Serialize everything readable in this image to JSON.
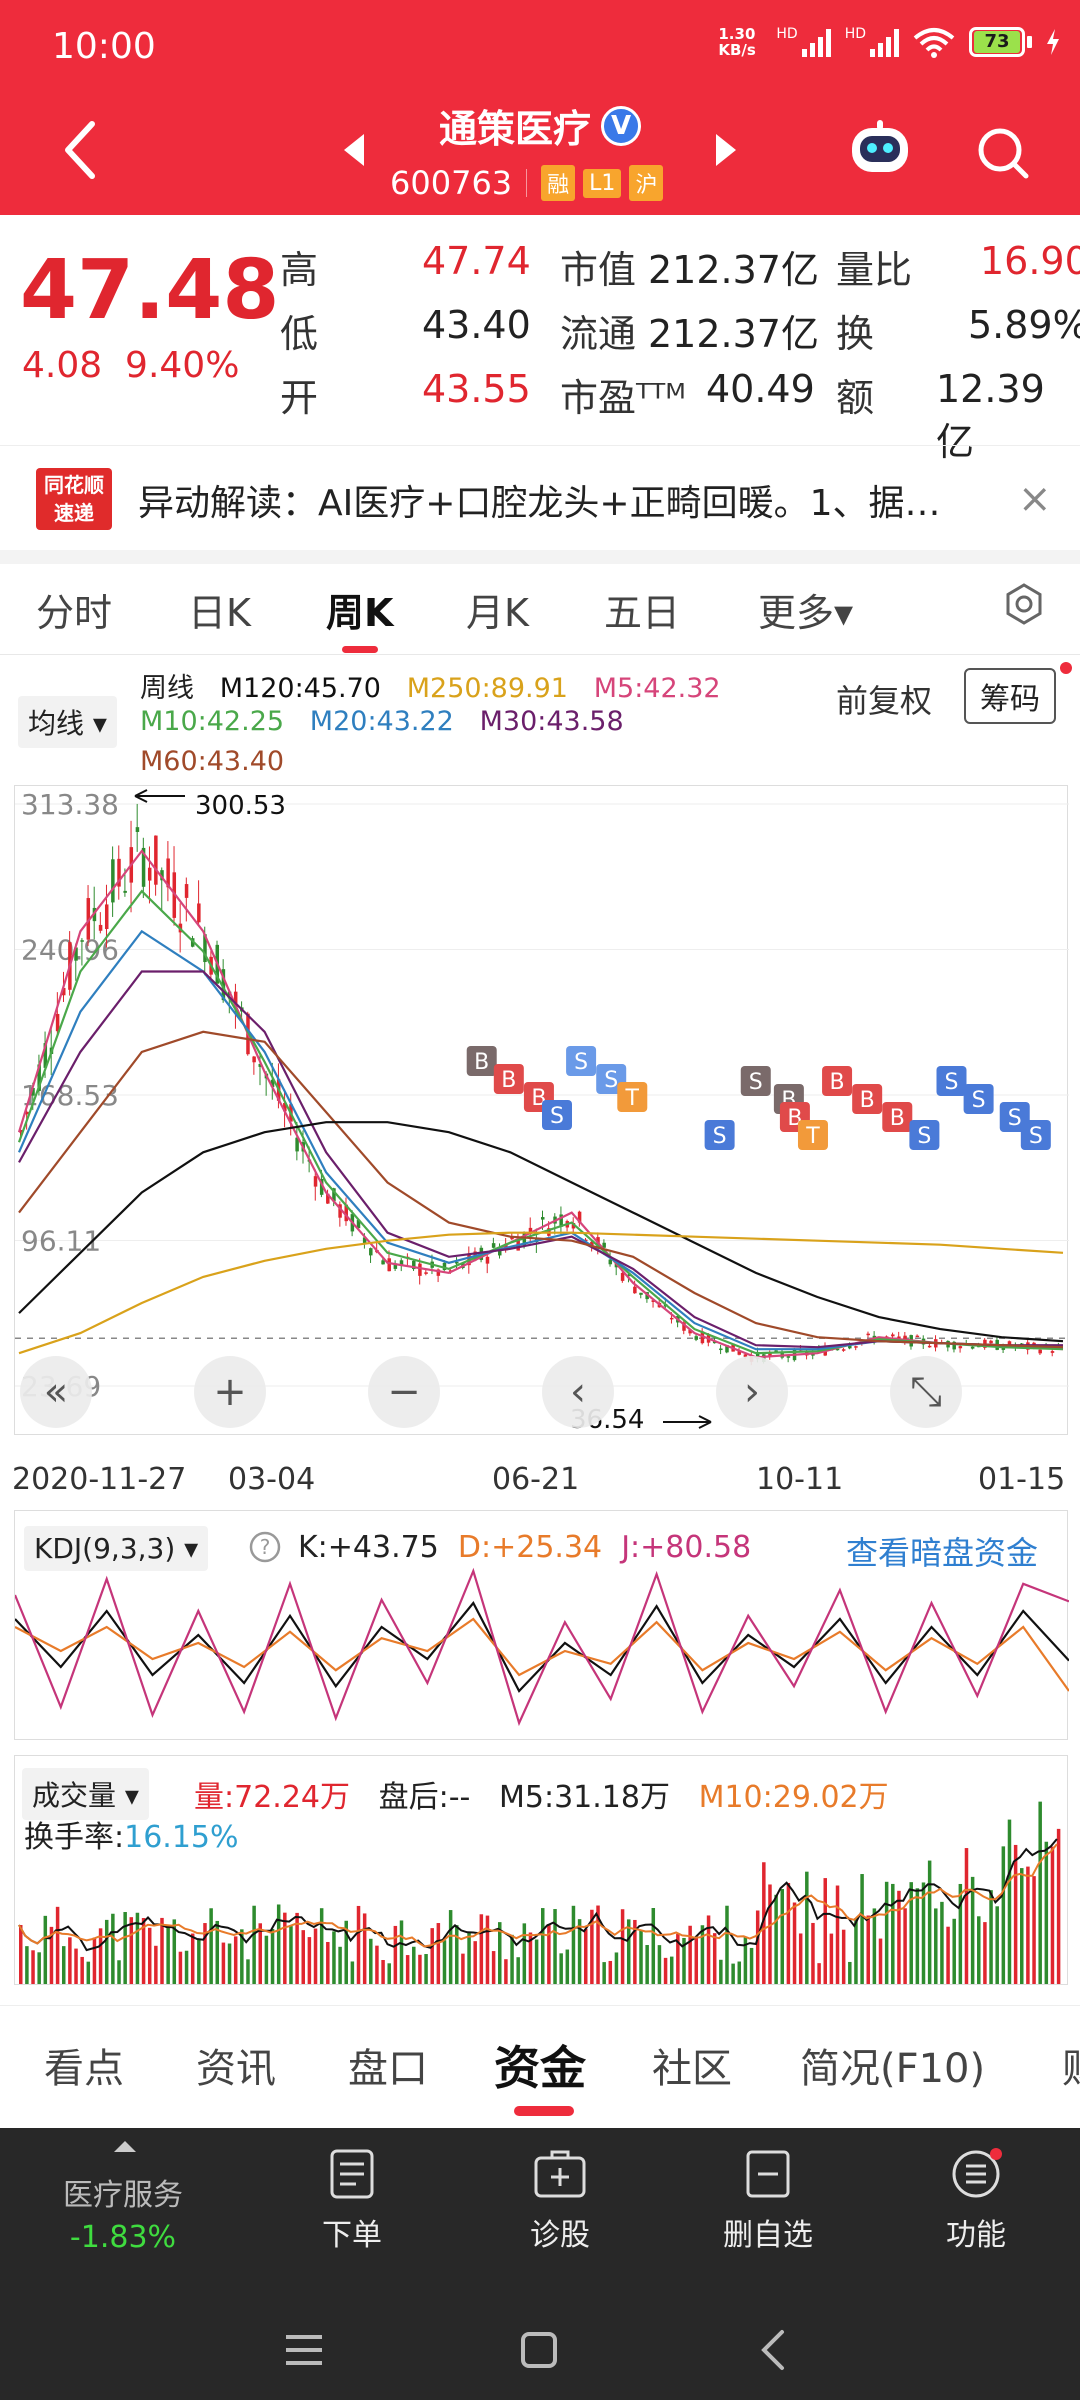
{
  "status": {
    "time": "10:00",
    "net_speed": "1.30 KB/s",
    "battery": "73",
    "hd1": "HD",
    "hd2": "HD"
  },
  "header": {
    "stock_name": "通策医疗",
    "verified": "V",
    "code": "600763",
    "tags": [
      "融",
      "L1",
      "沪"
    ]
  },
  "quote": {
    "price": "47.48",
    "change": "4.08",
    "change_pct": "9.40%",
    "high_label": "高",
    "high": "47.74",
    "low_label": "低",
    "low": "43.40",
    "open_label": "开",
    "open": "43.55",
    "mktcap_label": "市值",
    "mktcap": "212.37亿",
    "float_label": "流通",
    "float": "212.37亿",
    "pe_label": "市盈ᵀᵀᴹ",
    "pe": "40.49",
    "vr_label": "量比",
    "vr": "16.90",
    "turn_label": "换",
    "turn": "5.89%",
    "amt_label": "额",
    "amt": "12.39亿"
  },
  "news": {
    "logo_line1": "同花顺",
    "logo_line2": "速递",
    "text": "异动解读：AI医疗+口腔龙头+正畸回暖。1、据…",
    "close": "×"
  },
  "period_tabs": [
    "分时",
    "日K",
    "周K",
    "月K",
    "五日",
    "更多▾"
  ],
  "ma": {
    "selector": "均线 ▾",
    "prefix": "周线",
    "m120": "M120:45.70",
    "m250": "M250:89.91",
    "m5": "M5:42.32",
    "m10": "M10:42.25",
    "m20": "M20:43.22",
    "m30": "M30:43.58",
    "m60": "M60:43.40",
    "adjust": "前复权",
    "chips": "筹码"
  },
  "colors": {
    "accent": "#ee2c3c",
    "up": "#e0262f",
    "down": "#2e8b2e",
    "m5": "#d6457a",
    "m10": "#4aa84a",
    "m20": "#2f7fbf",
    "m30": "#6b1f6b",
    "m60": "#a04a2a",
    "m120": "#111111",
    "m250": "#d9a21b"
  },
  "chart_data": [
    {
      "type": "line",
      "title": "周线",
      "x_ticks": [
        "2020-11-27",
        "03-04",
        "06-21",
        "10-11",
        "01-15"
      ],
      "y_ticks": [
        "313.38",
        "240.96",
        "168.53",
        "96.11",
        "23.69"
      ],
      "ylim": [
        23.69,
        313.38
      ],
      "high_marker": "300.53",
      "low_marker": "36.54",
      "series": [
        {
          "name": "M5",
          "values": [
            150,
            250,
            290,
            250,
            180,
            120,
            85,
            80,
            95,
            110,
            75,
            50,
            38,
            40,
            48,
            45,
            44,
            42
          ]
        },
        {
          "name": "M10",
          "values": [
            145,
            230,
            270,
            240,
            185,
            125,
            90,
            82,
            95,
            105,
            78,
            52,
            40,
            41,
            47,
            45,
            43,
            42
          ]
        },
        {
          "name": "M20",
          "values": [
            140,
            210,
            250,
            230,
            190,
            130,
            95,
            85,
            93,
            100,
            80,
            55,
            42,
            42,
            46,
            45,
            44,
            43
          ]
        },
        {
          "name": "M30",
          "values": [
            135,
            190,
            230,
            230,
            200,
            140,
            100,
            88,
            92,
            98,
            82,
            58,
            44,
            43,
            46,
            45,
            44,
            44
          ]
        },
        {
          "name": "M60",
          "values": [
            110,
            150,
            190,
            200,
            195,
            160,
            125,
            105,
            98,
            96,
            88,
            70,
            55,
            48,
            46,
            45,
            44,
            43
          ]
        },
        {
          "name": "M120",
          "values": [
            60,
            90,
            120,
            140,
            150,
            155,
            155,
            150,
            140,
            125,
            110,
            95,
            80,
            68,
            58,
            52,
            48,
            46
          ]
        },
        {
          "name": "M250",
          "values": [
            40,
            50,
            65,
            78,
            86,
            92,
            96,
            99,
            100,
            100,
            99,
            98,
            97,
            96,
            95,
            94,
            92,
            90
          ]
        }
      ]
    },
    {
      "type": "line",
      "title": "KDJ(9,3,3)",
      "k": "+43.75",
      "d": "+25.34",
      "j": "+80.58",
      "series": [
        {
          "name": "K",
          "values": [
            70,
            40,
            75,
            35,
            60,
            30,
            72,
            28,
            65,
            45,
            80,
            25,
            55,
            35,
            78,
            30,
            60,
            40,
            70,
            30,
            65,
            35,
            75,
            44
          ]
        },
        {
          "name": "D",
          "values": [
            65,
            50,
            65,
            45,
            55,
            40,
            62,
            38,
            58,
            50,
            70,
            35,
            50,
            42,
            68,
            38,
            55,
            45,
            62,
            38,
            58,
            42,
            65,
            25
          ]
        },
        {
          "name": "J",
          "values": [
            85,
            15,
            95,
            10,
            75,
            12,
            92,
            8,
            82,
            30,
            100,
            5,
            68,
            20,
            98,
            12,
            72,
            28,
            88,
            12,
            80,
            22,
            92,
            81
          ]
        }
      ]
    },
    {
      "type": "bar",
      "title": "成交量",
      "volume": "量:72.24万",
      "after_hours": "盘后:--",
      "m5": "M5:31.18万",
      "m10": "M10:29.02万",
      "turnover_label": "换手率:",
      "turnover": "16.15%"
    }
  ],
  "kdj": {
    "selector": "KDJ(9,3,3) ▾",
    "k": "K:+43.75",
    "d": "D:+25.34",
    "j": "J:+80.58",
    "link": "查看暗盘资金"
  },
  "vol": {
    "selector": "成交量 ▾",
    "volume": "量:72.24万",
    "after": "盘后:--",
    "m5": "M5:31.18万",
    "m10": "M10:29.02万",
    "turnover_label": "换手率:",
    "turnover": "16.15%"
  },
  "info_tabs": [
    "看点",
    "资讯",
    "盘口",
    "资金",
    "社区",
    "简况(F10)",
    "财"
  ],
  "toolbar": {
    "sector_name": "医疗服务",
    "sector_change": "-1.83%",
    "order": "下单",
    "diagnose": "诊股",
    "remove": "删自选",
    "func": "功能"
  }
}
